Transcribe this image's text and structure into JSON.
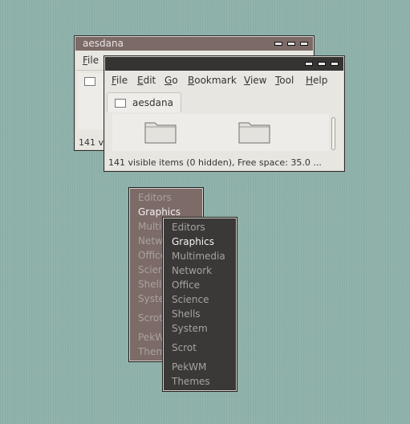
{
  "back_window": {
    "title": "aesdana",
    "menu": {
      "file": "File"
    },
    "status": "141 vi"
  },
  "front_window": {
    "menu": {
      "file": "File",
      "edit": "Edit",
      "go": "Go",
      "bookmark": "Bookmark",
      "view": "View",
      "tool": "Tool",
      "help": "Help"
    },
    "tab_label": "aesdana",
    "status": "141 visible items (0 hidden), Free space: 35.0 ..."
  },
  "menu_back": {
    "items": [
      "Editors",
      "Graphics",
      "Multi",
      "Netw",
      "Office",
      "Scien",
      "Shells",
      "Syste",
      "Scrot",
      "PekWi",
      "Theme"
    ]
  },
  "menu_front": {
    "items": [
      "Editors",
      "Graphics",
      "Multimedia",
      "Network",
      "Office",
      "Science",
      "Shells",
      "System",
      "Scrot",
      "PekWM",
      "Themes"
    ]
  },
  "colors": {
    "desktop": "#8fb2ab",
    "menu_back_bg": "#7d6b68",
    "menu_front_bg": "#3a3938",
    "titlebar_back": "#7c6a66",
    "titlebar_front": "#353433"
  }
}
